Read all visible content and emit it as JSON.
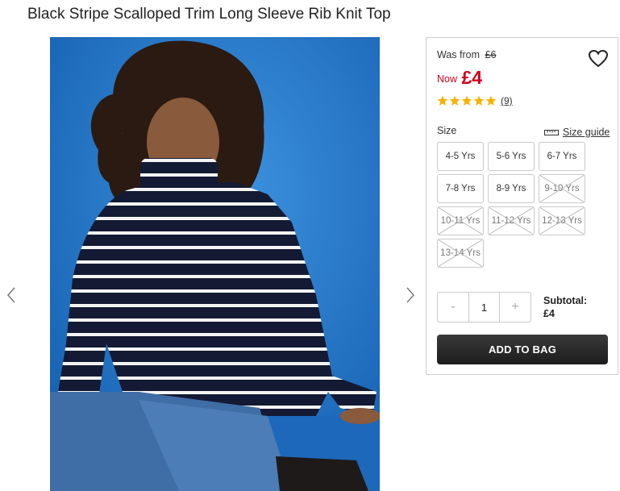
{
  "product": {
    "title": "Black Stripe Scalloped Trim Long Sleeve Rib Knit Top"
  },
  "gallery": {
    "image_alt": "Girl wearing black and white stripe rib knit top",
    "background_color": "#1f73c4"
  },
  "price": {
    "was_label": "Was from",
    "was_value": "£6",
    "now_label": "Now",
    "now_value": "£4",
    "now_color": "#d0021b"
  },
  "rating": {
    "stars": 5,
    "max_stars": 5,
    "count_text": "(9)",
    "star_color": "#f5b301"
  },
  "size": {
    "label": "Size",
    "guide_label": "Size guide",
    "options": [
      {
        "label": "4-5 Yrs",
        "available": true
      },
      {
        "label": "5-6 Yrs",
        "available": true
      },
      {
        "label": "6-7 Yrs",
        "available": true
      },
      {
        "label": "7-8 Yrs",
        "available": true
      },
      {
        "label": "8-9 Yrs",
        "available": true
      },
      {
        "label": "9-10 Yrs",
        "available": false
      },
      {
        "label": "10-11 Yrs",
        "available": false
      },
      {
        "label": "11-12 Yrs",
        "available": false
      },
      {
        "label": "12-13 Yrs",
        "available": false
      },
      {
        "label": "13-14 Yrs",
        "available": false
      }
    ]
  },
  "quantity": {
    "minus": "-",
    "value": "1",
    "plus": "+"
  },
  "subtotal": {
    "label": "Subtotal:",
    "value": "£4"
  },
  "actions": {
    "add_to_bag": "ADD TO BAG"
  }
}
